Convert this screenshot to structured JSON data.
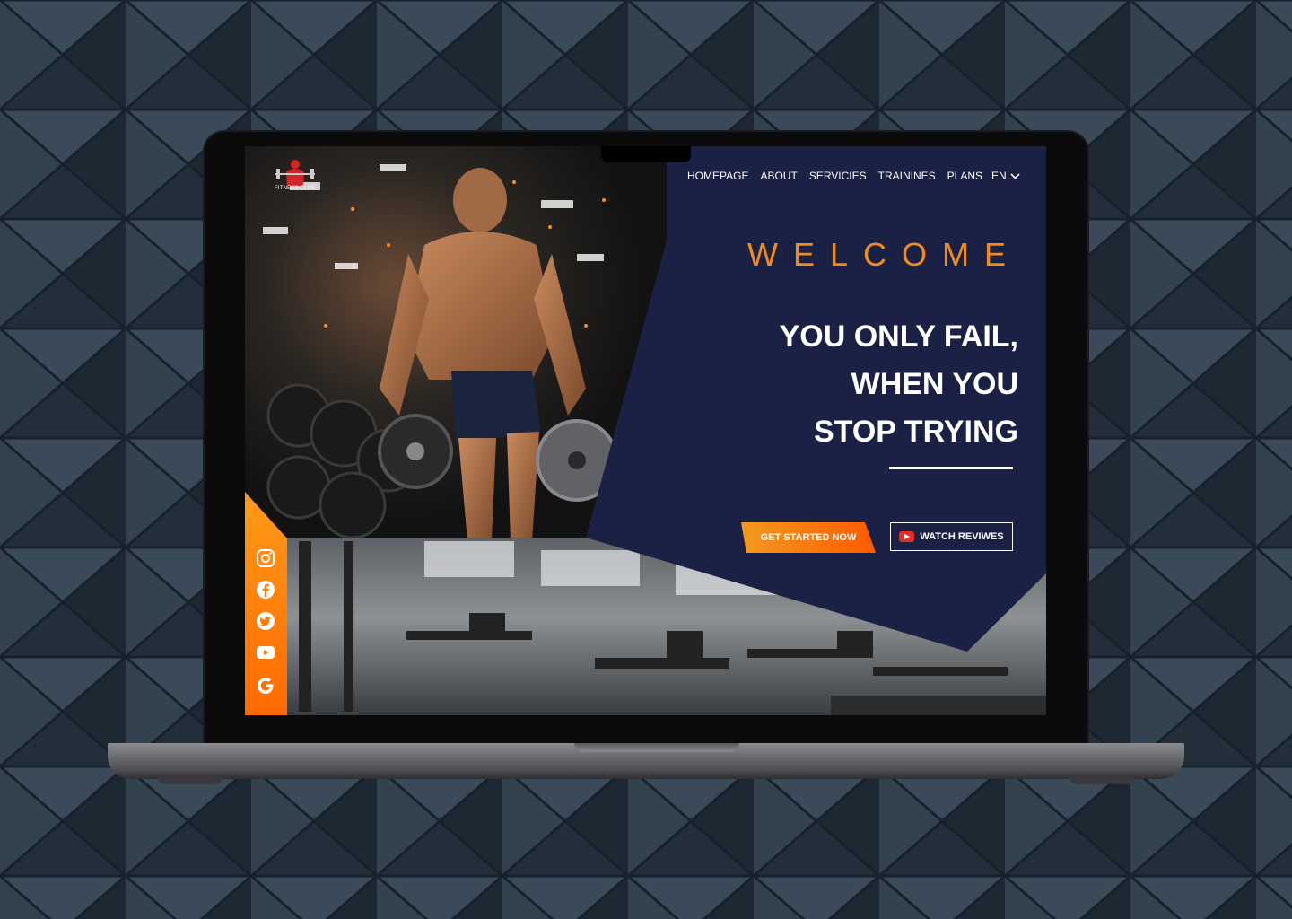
{
  "brand": {
    "logo_text": "FITNESS CLUB"
  },
  "nav": {
    "items": [
      {
        "label": "HOMEPAGE"
      },
      {
        "label": "ABOUT"
      },
      {
        "label": "SERVICIES"
      },
      {
        "label": "TRAININES"
      },
      {
        "label": "PLANS"
      }
    ],
    "language": "EN"
  },
  "hero": {
    "welcome": "WELCOME",
    "headline": [
      "YOU ONLY FAIL,",
      "WHEN YOU",
      "STOP TRYING"
    ],
    "cta_primary": "GET STARTED NOW",
    "cta_secondary": "WATCH REVIWES"
  },
  "social": [
    {
      "icon": "instagram-icon"
    },
    {
      "icon": "facebook-icon"
    },
    {
      "icon": "twitter-icon"
    },
    {
      "icon": "youtube-icon"
    },
    {
      "icon": "google-icon"
    }
  ],
  "colors": {
    "accent": "#f08c1e",
    "navy": "#1b2144",
    "social_bar": "#ff7a00",
    "youtube": "#e52d27"
  }
}
